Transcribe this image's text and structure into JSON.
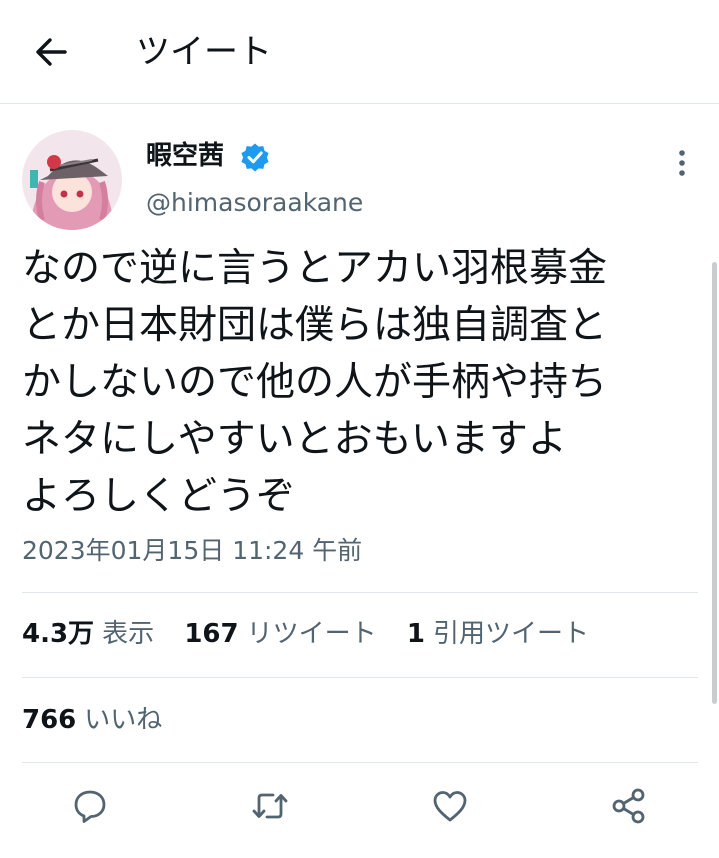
{
  "header": {
    "title": "ツイート",
    "back_icon": "arrow-left-icon"
  },
  "author": {
    "name": "暇空茜",
    "handle": "@himasoraakane",
    "verified": true,
    "verified_color": "#1d9bf0"
  },
  "tweet": {
    "lines": [
      "なので逆に言うとアカい羽根募金",
      "とか日本財団は僕らは独自調査と",
      "かしないので他の人が手柄や持ち",
      "ネタにしやすいとおもいますよ",
      "よろしくどうぞ"
    ],
    "timestamp": "2023年01月15日 11:24 午前"
  },
  "stats": {
    "views": {
      "count": "4.3万",
      "label": "表示"
    },
    "retweets": {
      "count": "167",
      "label": "リツイート"
    },
    "quotes": {
      "count": "1",
      "label": "引用ツイート"
    },
    "likes": {
      "count": "766",
      "label": "いいね"
    }
  },
  "actions": [
    {
      "icon": "reply-icon"
    },
    {
      "icon": "retweet-icon"
    },
    {
      "icon": "like-icon"
    },
    {
      "icon": "share-icon"
    }
  ],
  "colors": {
    "text_primary": "#0f1419",
    "text_secondary": "#536471",
    "divider": "#e1e6ea"
  }
}
